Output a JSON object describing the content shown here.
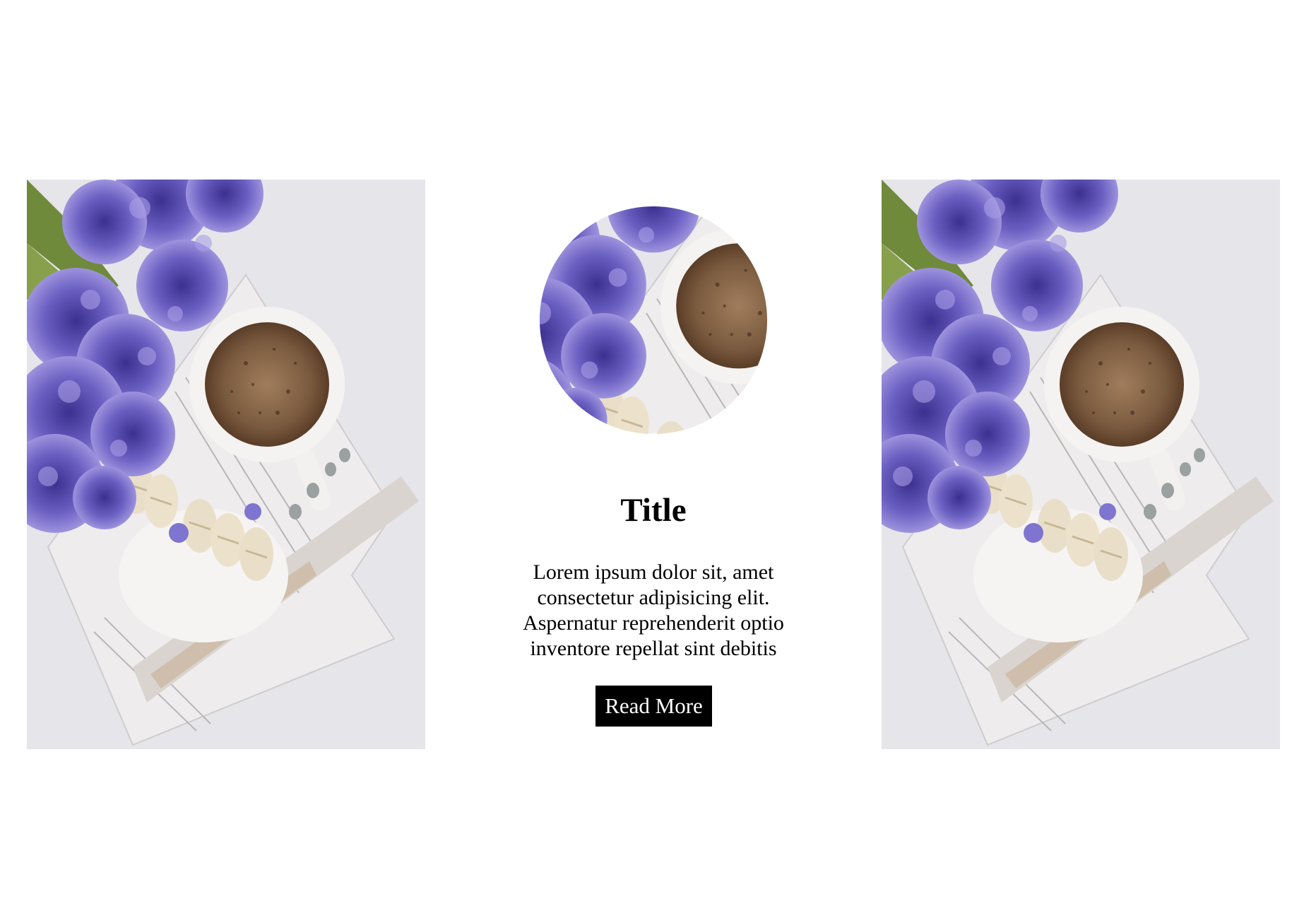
{
  "images": {
    "left_photo_icon": "coffee-flowers-photo",
    "right_photo_icon": "coffee-flowers-photo",
    "thumbnail_icon": "coffee-flowers-photo"
  },
  "card": {
    "title": "Title",
    "body": "Lorem ipsum dolor sit, amet consectetur adipisicing elit. Aspernatur reprehenderit optio inventore repellat sint debitis",
    "button_label": "Read More"
  },
  "colors": {
    "background": "#ffffff",
    "button_bg": "#000000",
    "button_text": "#ffffff",
    "accent_flowers": "#6b5fc2"
  }
}
